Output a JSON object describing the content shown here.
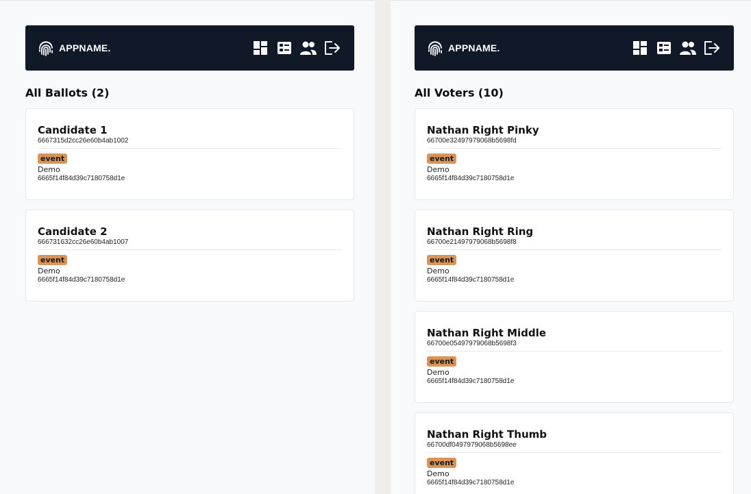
{
  "colors": {
    "navbar_bg": "#111827",
    "badge_bg": "#d99459",
    "panel_bg": "#f8f9fb"
  },
  "left": {
    "brand": {
      "icon": "fingerprint-icon",
      "name": "APPNAME."
    },
    "nav_icons": [
      "dashboard-icon",
      "ballot-list-icon",
      "users-icon",
      "logout-icon"
    ],
    "section_title": "All Ballots (2)",
    "cards": [
      {
        "title": "Candidate 1",
        "id": "6667315d2cc26e60b4ab1002",
        "badge": "event",
        "event_name": "Demo",
        "event_id": "6665f14f84d39c7180758d1e"
      },
      {
        "title": "Candidate 2",
        "id": "666731632cc26e60b4ab1007",
        "badge": "event",
        "event_name": "Demo",
        "event_id": "6665f14f84d39c7180758d1e"
      }
    ]
  },
  "right": {
    "brand": {
      "icon": "fingerprint-icon",
      "name": "APPNAME."
    },
    "nav_icons": [
      "dashboard-icon",
      "ballot-list-icon",
      "users-icon",
      "logout-icon"
    ],
    "section_title": "All Voters (10)",
    "cards": [
      {
        "title": "Nathan Right Pinky",
        "id": "66700e32497979068b5698fd",
        "badge": "event",
        "event_name": "Demo",
        "event_id": "6665f14f84d39c7180758d1e"
      },
      {
        "title": "Nathan Right Ring",
        "id": "66700e21497979068b5698f8",
        "badge": "event",
        "event_name": "Demo",
        "event_id": "6665f14f84d39c7180758d1e"
      },
      {
        "title": "Nathan Right Middle",
        "id": "66700e05497979068b5698f3",
        "badge": "event",
        "event_name": "Demo",
        "event_id": "6665f14f84d39c7180758d1e"
      },
      {
        "title": "Nathan Right Thumb",
        "id": "66700df0497979068b5698ee",
        "badge": "event",
        "event_name": "Demo",
        "event_id": "6665f14f84d39c7180758d1e"
      }
    ]
  }
}
